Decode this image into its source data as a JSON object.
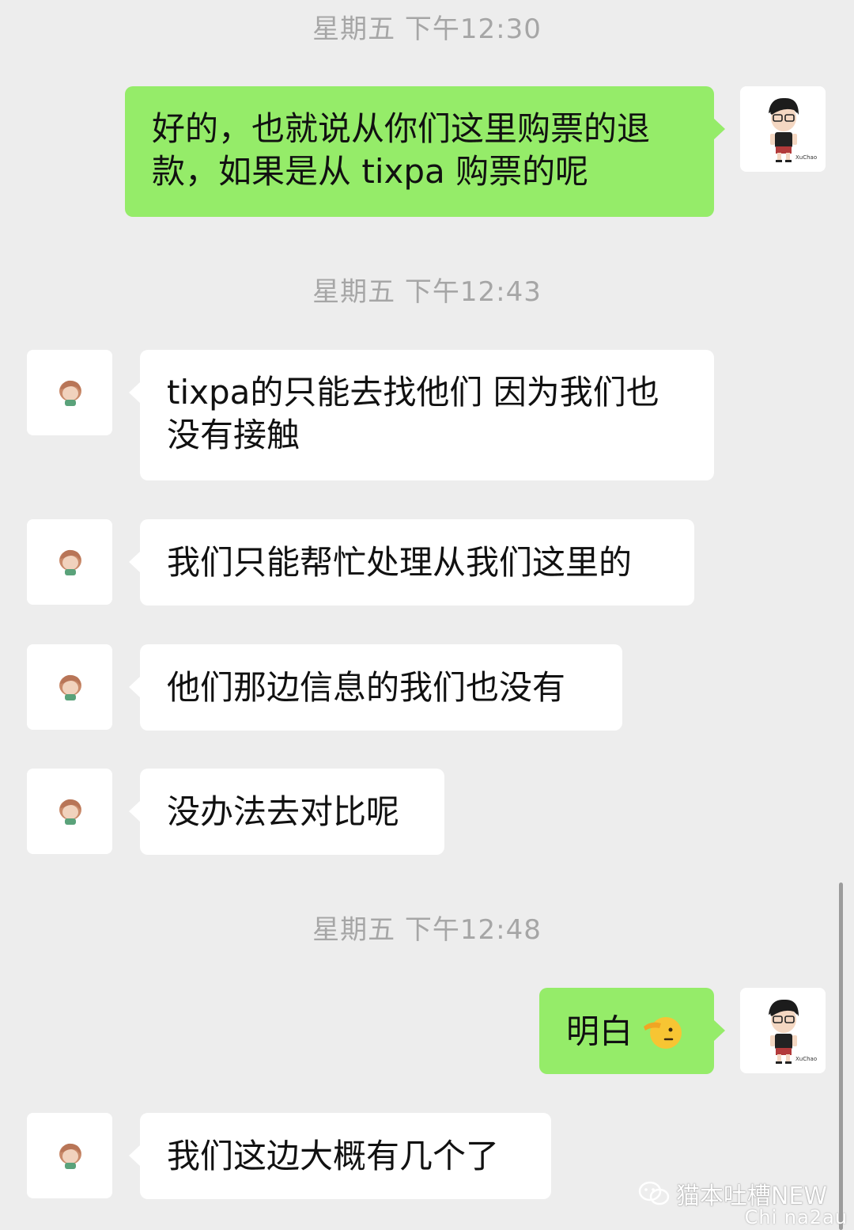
{
  "timestamps": [
    "星期五 下午12:30",
    "星期五 下午12:43",
    "星期五 下午12:48"
  ],
  "messages": [
    {
      "text": "好的，也就说从你们这里购票的退款，如果是从 tixpa 购票的呢",
      "line1": "好的，也就说从你们这里购票的退",
      "line2": "款，如果是从 tixpa 购票的呢"
    },
    {
      "text": "tixpa的只能去找他们 因为我们也没有接触",
      "line1": "tixpa的只能去找他们 因为我们也",
      "line2": "没有接触"
    },
    {
      "text": "我们只能帮忙处理从我们这里的"
    },
    {
      "text": "他们那边信息的我们也没有"
    },
    {
      "text": "没办法去对比呢"
    },
    {
      "text": "明白",
      "emoji": "saluting-face"
    },
    {
      "text": "我们这边大概有几个了"
    }
  ],
  "avatar_labels": {
    "self": "XuChao"
  },
  "watermark": {
    "title": "猫本吐槽NEW",
    "subtitle": "Chi na2au"
  },
  "colors": {
    "background": "#ededed",
    "sent_bubble": "#95ec69",
    "received_bubble": "#ffffff",
    "timestamp": "#a6a6a6"
  }
}
